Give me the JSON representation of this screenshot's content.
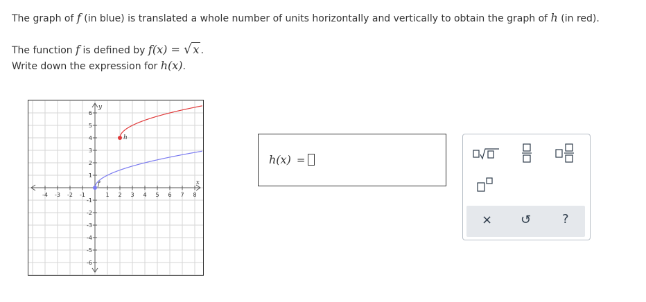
{
  "problem": {
    "line1_a": "The graph of ",
    "f": "f",
    "line1_b": " (in blue) is translated a whole number of units horizontally and vertically to obtain the graph of ",
    "h": "h",
    "line1_c": " (in red).",
    "line2_a": "The function ",
    "line2_b": " is defined by ",
    "line2_func": "f(x) = ",
    "sqrt_x": "x",
    "line2_end": ".",
    "line3_a": "Write down the expression for ",
    "line3_expr": "h(x)",
    "line3_end": "."
  },
  "graph": {
    "x_label": "x",
    "y_label": "y",
    "x_ticks": [
      "-4",
      "-3",
      "-2",
      "-1",
      "1",
      "2",
      "3",
      "4",
      "5",
      "6",
      "7",
      "8"
    ],
    "y_ticks": [
      "6",
      "5",
      "4",
      "3",
      "2",
      "1",
      "-1",
      "-2",
      "-3",
      "-4",
      "-5",
      "-6"
    ],
    "f_label": "f",
    "h_label": "h",
    "colors": {
      "f": "#7b7bf0",
      "h": "#e03a3a",
      "grid": "#d6d6d6",
      "axis": "#555555"
    },
    "f_start": [
      0,
      0
    ],
    "h_start": [
      2,
      4
    ]
  },
  "answer": {
    "lhs": "h(x)",
    "equals": "="
  },
  "palette": {
    "buttons": [
      "sqrt-template",
      "fraction-template",
      "mixed-number-template",
      "exponent-template"
    ],
    "actions": {
      "clear": "×",
      "undo": "↺",
      "help": "?"
    }
  }
}
